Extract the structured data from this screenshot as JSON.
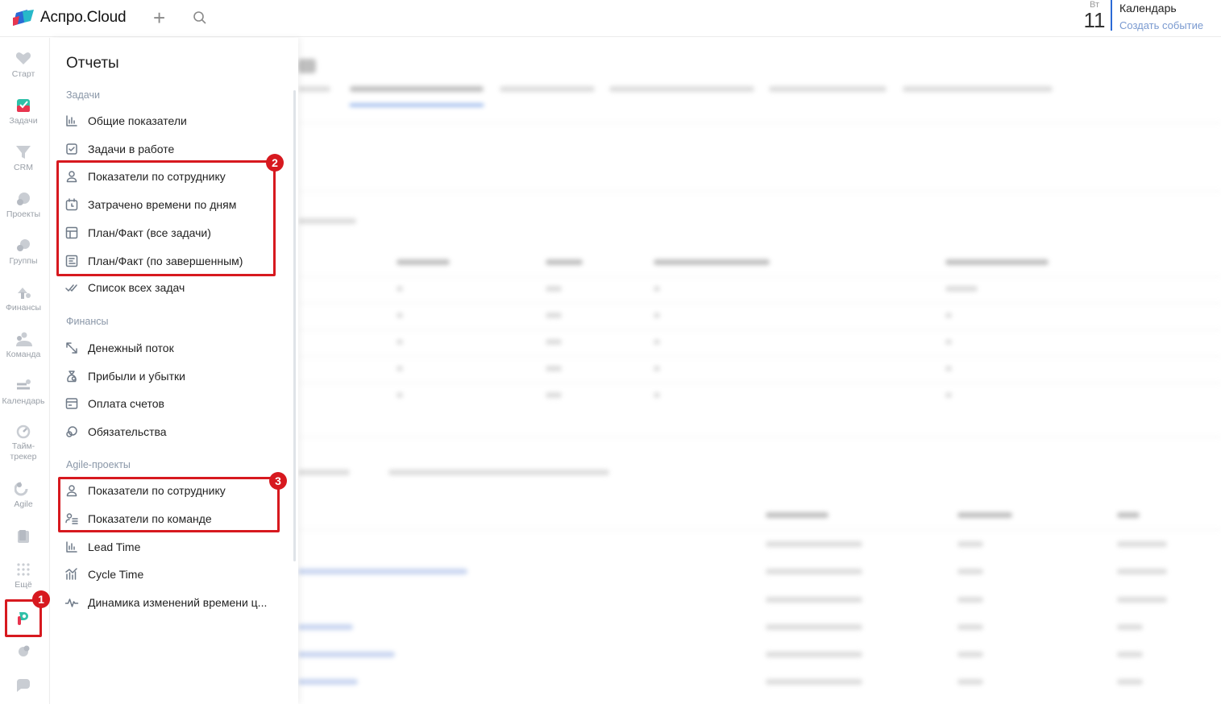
{
  "header": {
    "brand": "Аспро.Cloud",
    "calendar": {
      "weekday": "Вт",
      "day": "11",
      "title": "Календарь",
      "create_event": "Создать событие"
    }
  },
  "rail": {
    "items": [
      {
        "label": "Старт",
        "icon": "heart-icon"
      },
      {
        "label": "Задачи",
        "icon": "tasks-icon"
      },
      {
        "label": "CRM",
        "icon": "funnel-icon"
      },
      {
        "label": "Проекты",
        "icon": "projects-icon"
      },
      {
        "label": "Группы",
        "icon": "groups-icon"
      },
      {
        "label": "Финансы",
        "icon": "finance-icon"
      },
      {
        "label": "Команда",
        "icon": "team-icon"
      },
      {
        "label": "Календарь",
        "icon": "calendar-icon"
      },
      {
        "label": "Тайм-трекер",
        "icon": "timer-icon"
      },
      {
        "label": "Agile",
        "icon": "agile-icon"
      },
      {
        "label": "",
        "icon": "base-icon"
      },
      {
        "label": "Ещё",
        "icon": "more-grid-icon"
      },
      {
        "label": "",
        "icon": "reports-icon"
      },
      {
        "label": "",
        "icon": "settings-icon"
      },
      {
        "label": "",
        "icon": "chat-icon"
      }
    ]
  },
  "panel": {
    "title": "Отчеты",
    "sections": [
      {
        "title": "Задачи",
        "items": [
          {
            "label": "Общие показатели",
            "icon": "bar-chart-icon"
          },
          {
            "label": "Задачи в работе",
            "icon": "checkbox-icon"
          },
          {
            "label": "Показатели по сотруднику",
            "icon": "user-icon"
          },
          {
            "label": "Затрачено времени по дням",
            "icon": "calendar-clock-icon"
          },
          {
            "label": "План/Факт (все задачи)",
            "icon": "table-icon"
          },
          {
            "label": "План/Факт (по завершенным)",
            "icon": "list-table-icon"
          },
          {
            "label": "Список всех задач",
            "icon": "double-check-icon"
          }
        ]
      },
      {
        "title": "Финансы",
        "items": [
          {
            "label": "Денежный поток",
            "icon": "arrows-icon"
          },
          {
            "label": "Прибыли и убытки",
            "icon": "money-bag-icon"
          },
          {
            "label": "Оплата счетов",
            "icon": "invoice-icon"
          },
          {
            "label": "Обязательства",
            "icon": "obligation-icon"
          }
        ]
      },
      {
        "title": "Agile-проекты",
        "items": [
          {
            "label": "Показатели по сотруднику",
            "icon": "user-icon"
          },
          {
            "label": "Показатели по команде",
            "icon": "team-list-icon"
          },
          {
            "label": "Lead Time",
            "icon": "bar-chart-icon"
          },
          {
            "label": "Cycle Time",
            "icon": "trend-chart-icon"
          },
          {
            "label": "Динамика изменений времени ц...",
            "icon": "pulse-icon"
          }
        ]
      }
    ]
  },
  "callouts": {
    "one": "1",
    "two": "2",
    "three": "3"
  },
  "colors": {
    "highlight": "#d7191f",
    "accent": "#2b6ad6"
  }
}
